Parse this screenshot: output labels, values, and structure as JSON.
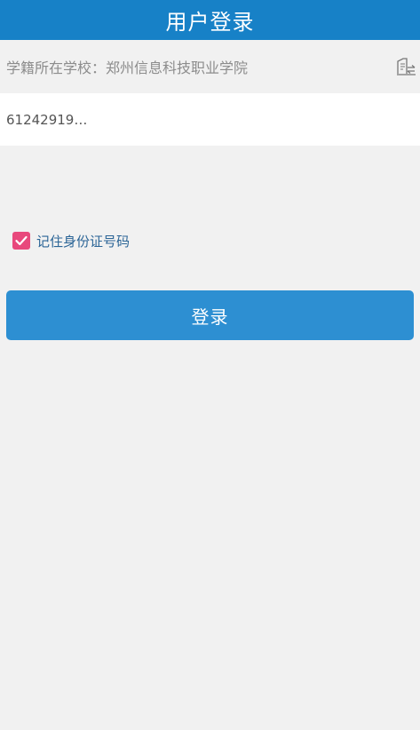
{
  "header": {
    "title": "用户登录"
  },
  "school": {
    "label": "学籍所在学校：",
    "name": "郑州信息科技职业学院",
    "switch_icon": "switch-school-icon"
  },
  "id_field": {
    "value": "61242919…"
  },
  "remember": {
    "checked": true,
    "label": "记住身份证号码"
  },
  "login": {
    "label": "登录"
  },
  "colors": {
    "header_bg": "#1781c7",
    "button_bg": "#2d8fd2",
    "checkbox": "#e8487c"
  }
}
